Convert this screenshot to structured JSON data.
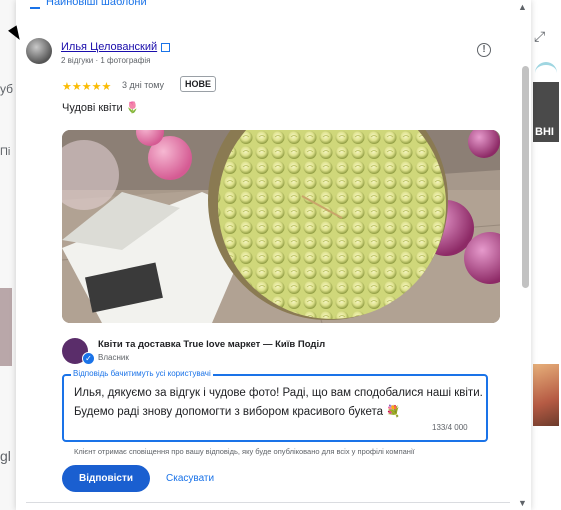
{
  "sort": {
    "label": "Найновіші шаблони"
  },
  "review": {
    "author": "Илья Целованский",
    "meta": "2 відгуки · 1 фотографія",
    "stars": "★★★★★",
    "time": "3 дні тому",
    "badge": "НОВЕ",
    "text": "Чудові квіти 🌷"
  },
  "owner": {
    "name": "Квіти та доставка True love маркет — Київ Поділ",
    "role": "Власник"
  },
  "reply": {
    "label": "Відповідь бачитимуть усі користувачі",
    "text": "Илья, дякуємо за відгук і чудове фото! Раді, що вам сподобалися наші квіти. Будемо раді знову допомогти з вибором красивого букета 💐",
    "count": "133/4 000",
    "notice": "Клієнт отримає сповіщення про вашу відповідь, яку буде опубліковано для всіх у профілі компанії"
  },
  "buttons": {
    "reply": "Відповісти",
    "cancel": "Скасувати"
  },
  "background": {
    "left_frag1": "уб",
    "left_frag2": "Пі",
    "left_frag3": "gl",
    "right_tile": "ВНІ"
  },
  "colors": {
    "accent": "#1a73e8",
    "button": "#1a5fd0",
    "stars": "#fbbc04"
  },
  "icons": [
    "sort-icon",
    "external-link-icon",
    "flag-icon",
    "verified-icon",
    "expand-icon",
    "scroll-up-icon",
    "scroll-down-icon"
  ]
}
